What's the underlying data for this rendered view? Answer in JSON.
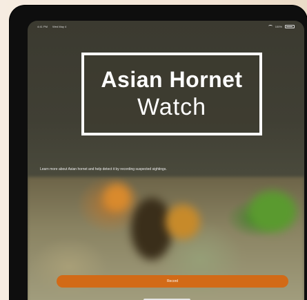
{
  "status_bar": {
    "time": "4:41 PM",
    "date": "Wed May 4",
    "battery": "100%"
  },
  "logo": {
    "line1": "Asian Hornet",
    "line2": "Watch"
  },
  "tagline": "Learn more about Asian hornet and help detect it by recording suspected sightings.",
  "record_button": {
    "label": "Record"
  },
  "colors": {
    "accent": "#d26a17",
    "header_bg": "#3b3a30"
  }
}
